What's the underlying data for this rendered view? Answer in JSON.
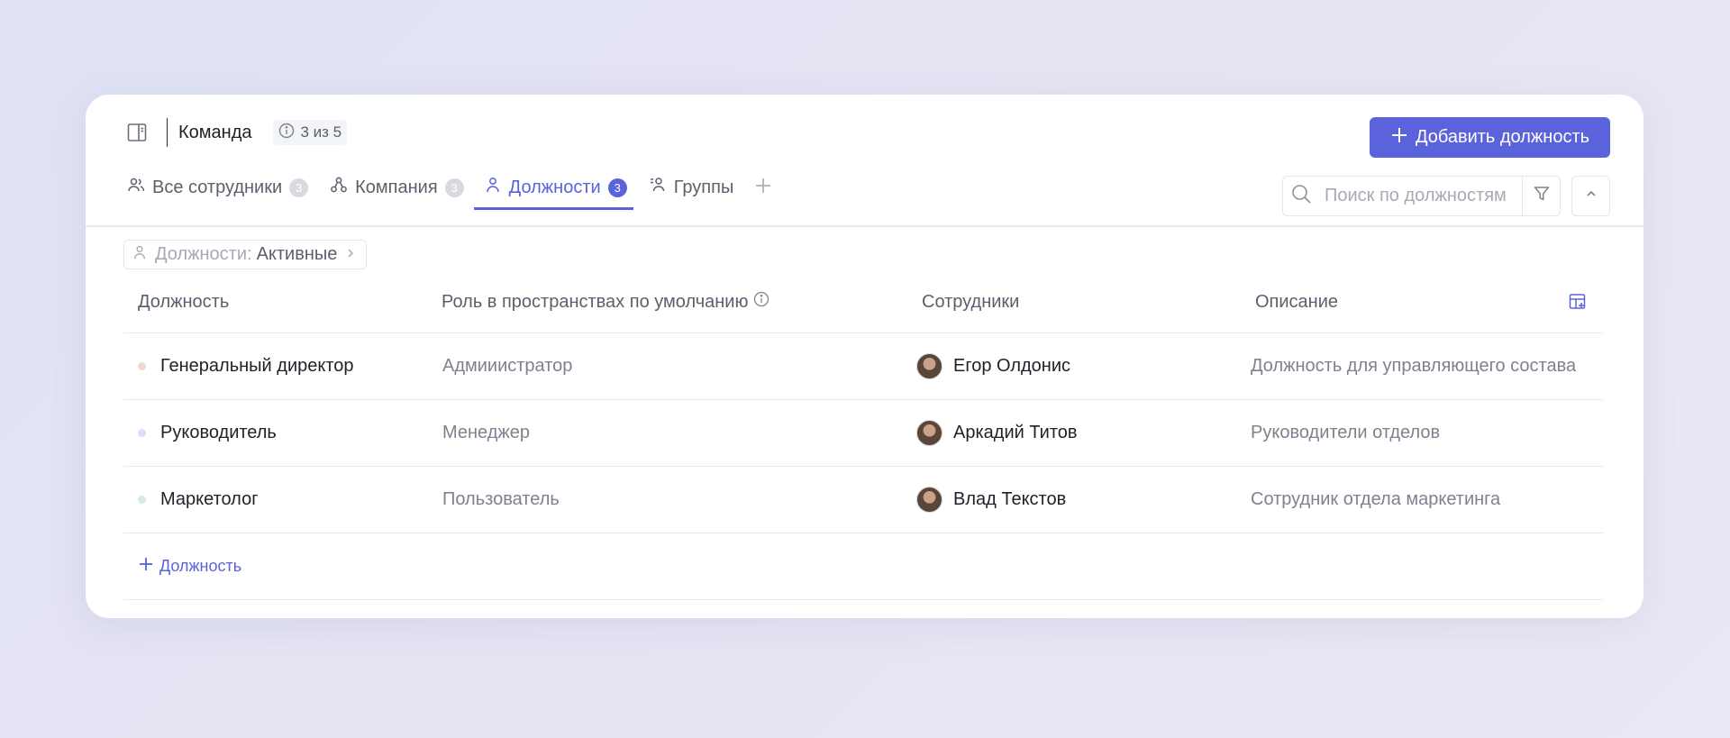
{
  "header": {
    "title": "Команда",
    "limit": "3 из 5",
    "add_button": "Добавить должность"
  },
  "tabs": [
    {
      "label": "Все сотрудники",
      "count": "3",
      "icon": "users-icon",
      "active": false
    },
    {
      "label": "Компания",
      "count": "3",
      "icon": "org-icon",
      "active": false
    },
    {
      "label": "Должности",
      "count": "3",
      "icon": "user-icon",
      "active": true
    },
    {
      "label": "Группы",
      "count": "",
      "icon": "group-icon",
      "active": false
    }
  ],
  "search": {
    "placeholder": "Поиск по должностям"
  },
  "filter_chip": {
    "label": "Должности:",
    "value": "Активные"
  },
  "table": {
    "columns": [
      "Должность",
      "Роль в пространствах по умолчанию",
      "Сотрудники",
      "Описание"
    ],
    "rows": [
      {
        "position": "Генеральный директор",
        "role": "Адмииистратор",
        "employee": "Егор Олдонис",
        "description": "Должность для управляющего состава",
        "dot_color": "#f4d7cc"
      },
      {
        "position": "Руководитель",
        "role": "Менеджер",
        "employee": "Аркадий Титов",
        "description": "Руководители отделов",
        "dot_color": "#dcdef7"
      },
      {
        "position": "Маркетолог",
        "role": "Пользователь",
        "employee": "Влад Текстов",
        "description": "Сотрудник отдела маркетинга",
        "dot_color": "#d4ebde"
      }
    ],
    "add_label": "Должность"
  },
  "colors": {
    "accent": "#5a62dc",
    "muted": "#7e828e"
  }
}
